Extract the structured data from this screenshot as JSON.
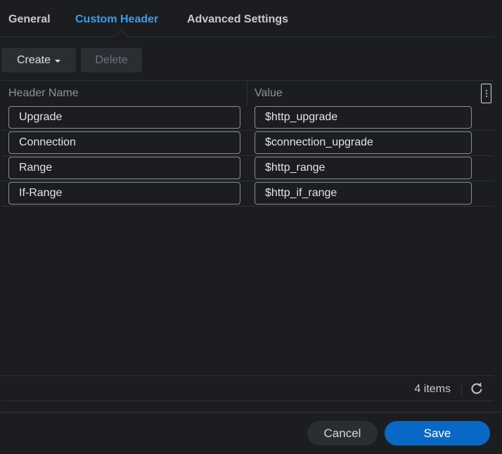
{
  "tabs": [
    {
      "label": "General",
      "active": false
    },
    {
      "label": "Custom Header",
      "active": true
    },
    {
      "label": "Advanced Settings",
      "active": false
    }
  ],
  "toolbar": {
    "create_label": "Create",
    "delete_label": "Delete"
  },
  "table": {
    "columns": [
      "Header Name",
      "Value"
    ],
    "rows": [
      {
        "name": "Upgrade",
        "value": "$http_upgrade"
      },
      {
        "name": "Connection",
        "value": "$connection_upgrade"
      },
      {
        "name": "Range",
        "value": "$http_range"
      },
      {
        "name": "If-Range",
        "value": "$http_if_range"
      }
    ],
    "item_count": "4 items"
  },
  "actions": {
    "cancel_label": "Cancel",
    "save_label": "Save"
  },
  "colors": {
    "accent": "#3b9cf0",
    "primary_button": "#0968c4",
    "background": "#1b1d21"
  },
  "icons": {
    "create_caret": "caret-down-icon",
    "column_menu": "vertical-dots-icon",
    "refresh": "refresh-icon"
  }
}
